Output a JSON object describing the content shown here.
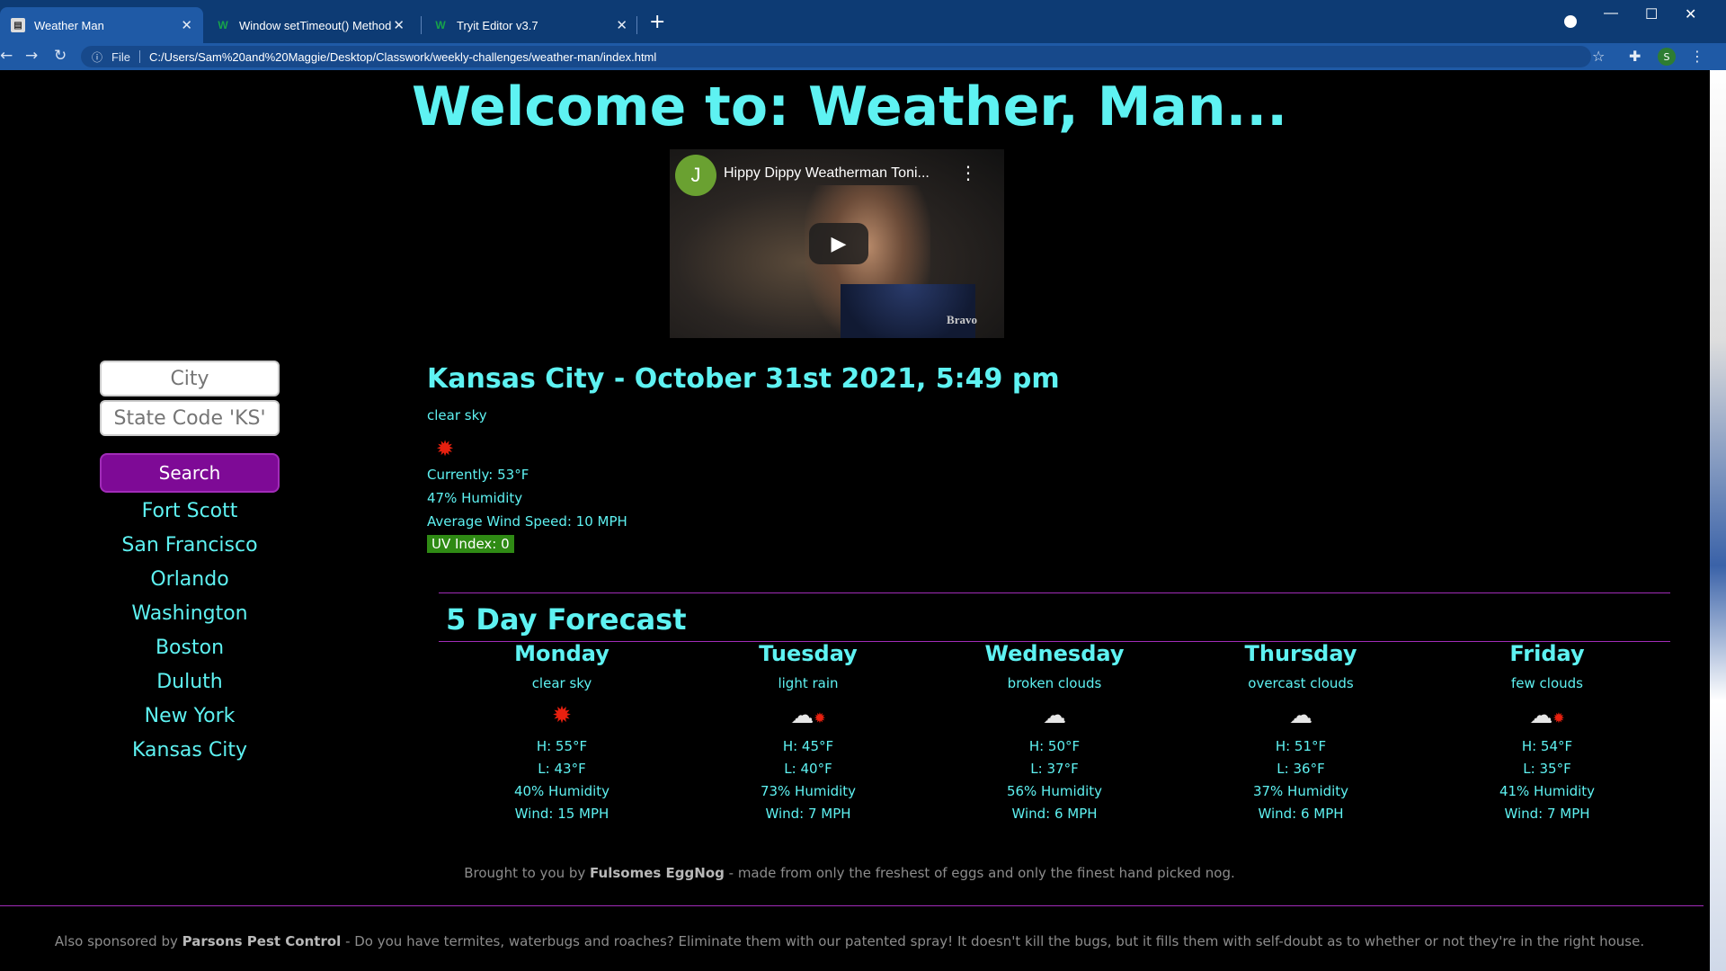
{
  "browser": {
    "tabs": [
      {
        "title": "Weather Man",
        "icon": "document-icon"
      },
      {
        "title": "Window setTimeout() Method",
        "icon": "w3schools-icon"
      },
      {
        "title": "Tryit Editor v3.7",
        "icon": "w3schools-icon"
      }
    ],
    "address": {
      "scheme_label": "File",
      "url": "C:/Users/Sam%20and%20Maggie/Desktop/Classwork/weekly-challenges/weather-man/index.html"
    },
    "profile_initial": "S"
  },
  "page": {
    "heading": "Welcome to: Weather, Man...",
    "video": {
      "channel_initial": "J",
      "title": "Hippy Dippy Weatherman Toni...",
      "watermark": "Bravo"
    },
    "search": {
      "city_placeholder": "City",
      "state_placeholder": "State Code 'KS'",
      "button_label": "Search"
    },
    "history": [
      "Fort Scott",
      "San Francisco",
      "Orlando",
      "Washington",
      "Boston",
      "Duluth",
      "New York",
      "Kansas City"
    ],
    "current": {
      "title": "Kansas City - October 31st 2021, 5:49 pm",
      "description": "clear sky",
      "icon": "sun-icon",
      "temp": "Currently: 53°F",
      "humidity": "47% Humidity",
      "wind": "Average Wind Speed: 10 MPH",
      "uv": "UV Index: 0",
      "uv_color": "#2f8a14"
    },
    "forecast": {
      "title": "5 Day Forecast",
      "days": [
        {
          "day": "Monday",
          "desc": "clear sky",
          "icon": "sun-icon",
          "high": "H: 55°F",
          "low": "L: 43°F",
          "humidity": "40% Humidity",
          "wind": "Wind: 15 MPH"
        },
        {
          "day": "Tuesday",
          "desc": "light rain",
          "icon": "rain-icon",
          "high": "H: 45°F",
          "low": "L: 40°F",
          "humidity": "73% Humidity",
          "wind": "Wind: 7 MPH"
        },
        {
          "day": "Wednesday",
          "desc": "broken clouds",
          "icon": "cloud-icon",
          "high": "H: 50°F",
          "low": "L: 37°F",
          "humidity": "56% Humidity",
          "wind": "Wind: 6 MPH"
        },
        {
          "day": "Thursday",
          "desc": "overcast clouds",
          "icon": "cloud-icon",
          "high": "H: 51°F",
          "low": "L: 36°F",
          "humidity": "37% Humidity",
          "wind": "Wind: 6 MPH"
        },
        {
          "day": "Friday",
          "desc": "few clouds",
          "icon": "partly-cloudy-icon",
          "high": "H: 54°F",
          "low": "L: 35°F",
          "humidity": "41% Humidity",
          "wind": "Wind: 7 MPH"
        }
      ]
    },
    "sponsor1": {
      "prefix": "Brought to you by ",
      "name": "Fulsomes EggNog",
      "suffix": " - made from only the freshest of eggs and only the finest hand picked nog."
    },
    "sponsor2": {
      "prefix": "Also sponsored by ",
      "name": "Parsons Pest Control",
      "suffix": " - Do you have termites, waterbugs and roaches? Eliminate them with our patented spray! It doesn't kill the bugs, but it fills them with self-doubt as to whether or not they're in the right house."
    },
    "colors": {
      "accent": "#5ef2f2",
      "button": "#7e0a96",
      "rule": "#a12cb8"
    }
  }
}
